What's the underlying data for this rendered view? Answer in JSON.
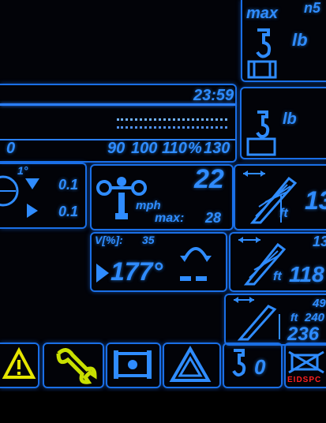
{
  "top_right": {
    "max_label": "max",
    "unit_lb": "lb",
    "corner_digits": "n5"
  },
  "load_panel": {
    "time": "23:59",
    "scale_ticks": [
      "90",
      "100",
      "110",
      "%",
      "130"
    ],
    "left_tick": "0",
    "right_unit": "lb"
  },
  "tilt_panel": {
    "angle_label": "1°",
    "value_down": "0.1",
    "value_right": "0.1"
  },
  "wind_panel": {
    "speed": "22",
    "unit": "mph",
    "max_label": "max:",
    "max_value": "28"
  },
  "slew_panel": {
    "percent_label": "V[%]:",
    "percent_value": "35",
    "angle": "177°"
  },
  "boom_panels": [
    {
      "value": "13",
      "unit": "ft"
    },
    {
      "value_top": "13",
      "value": "118",
      "unit": "ft"
    },
    {
      "value_top": "49",
      "value_mid": "240",
      "value": "236",
      "unit": "ft"
    }
  ],
  "bottom_bar": {
    "hook_value": "0",
    "status_text": "EIDSPC"
  },
  "colors": {
    "accent": "#2f8cff",
    "warning": "#e6e600",
    "alert": "#ff2020"
  }
}
